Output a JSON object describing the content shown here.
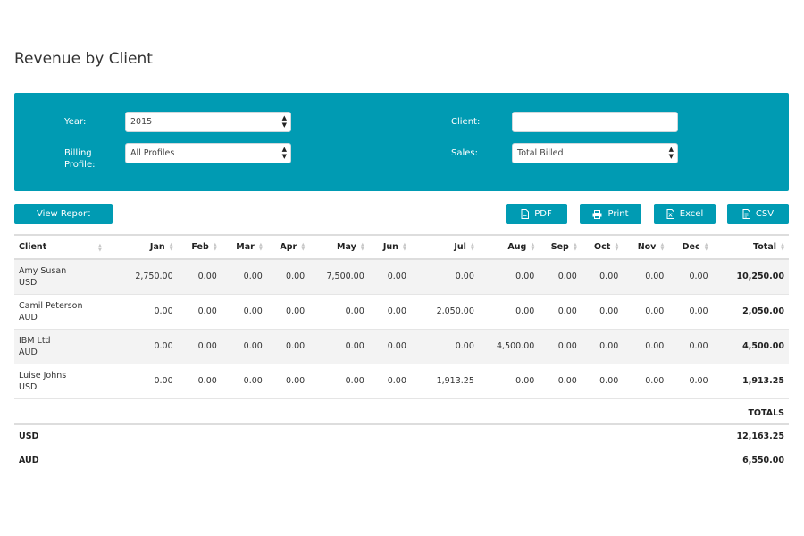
{
  "page": {
    "title": "Revenue by Client"
  },
  "filters": {
    "year_label": "Year:",
    "year_value": "2015",
    "billing_label_1": "Billing",
    "billing_label_2": "Profile:",
    "billing_value": "All Profiles",
    "client_label": "Client:",
    "client_value": "",
    "sales_label": "Sales:",
    "sales_value": "Total Billed"
  },
  "buttons": {
    "view_report": "View Report",
    "pdf": "PDF",
    "print": "Print",
    "excel": "Excel",
    "csv": "CSV"
  },
  "table": {
    "headers": [
      "Client",
      "Jan",
      "Feb",
      "Mar",
      "Apr",
      "May",
      "Jun",
      "Jul",
      "Aug",
      "Sep",
      "Oct",
      "Nov",
      "Dec",
      "Total"
    ],
    "rows": [
      {
        "name": "Amy Susan",
        "currency": "USD",
        "values": [
          "2,750.00",
          "0.00",
          "0.00",
          "0.00",
          "7,500.00",
          "0.00",
          "0.00",
          "0.00",
          "0.00",
          "0.00",
          "0.00",
          "0.00"
        ],
        "total": "10,250.00"
      },
      {
        "name": "Camil Peterson",
        "currency": "AUD",
        "values": [
          "0.00",
          "0.00",
          "0.00",
          "0.00",
          "0.00",
          "0.00",
          "2,050.00",
          "0.00",
          "0.00",
          "0.00",
          "0.00",
          "0.00"
        ],
        "total": "2,050.00"
      },
      {
        "name": "IBM Ltd",
        "currency": "AUD",
        "values": [
          "0.00",
          "0.00",
          "0.00",
          "0.00",
          "0.00",
          "0.00",
          "0.00",
          "4,500.00",
          "0.00",
          "0.00",
          "0.00",
          "0.00"
        ],
        "total": "4,500.00"
      },
      {
        "name": "Luise Johns",
        "currency": "USD",
        "values": [
          "0.00",
          "0.00",
          "0.00",
          "0.00",
          "0.00",
          "0.00",
          "1,913.25",
          "0.00",
          "0.00",
          "0.00",
          "0.00",
          "0.00"
        ],
        "total": "1,913.25"
      }
    ]
  },
  "totals": {
    "heading": "TOTALS",
    "rows": [
      {
        "currency": "USD",
        "amount": "12,163.25"
      },
      {
        "currency": "AUD",
        "amount": "6,550.00"
      }
    ]
  },
  "colors": {
    "accent": "#009bb3"
  },
  "icons": {
    "pdf": "document-icon",
    "print": "printer-icon",
    "excel": "spreadsheet-icon",
    "csv": "file-icon",
    "sort": "sort-arrows-icon",
    "select": "select-arrows-icon"
  }
}
